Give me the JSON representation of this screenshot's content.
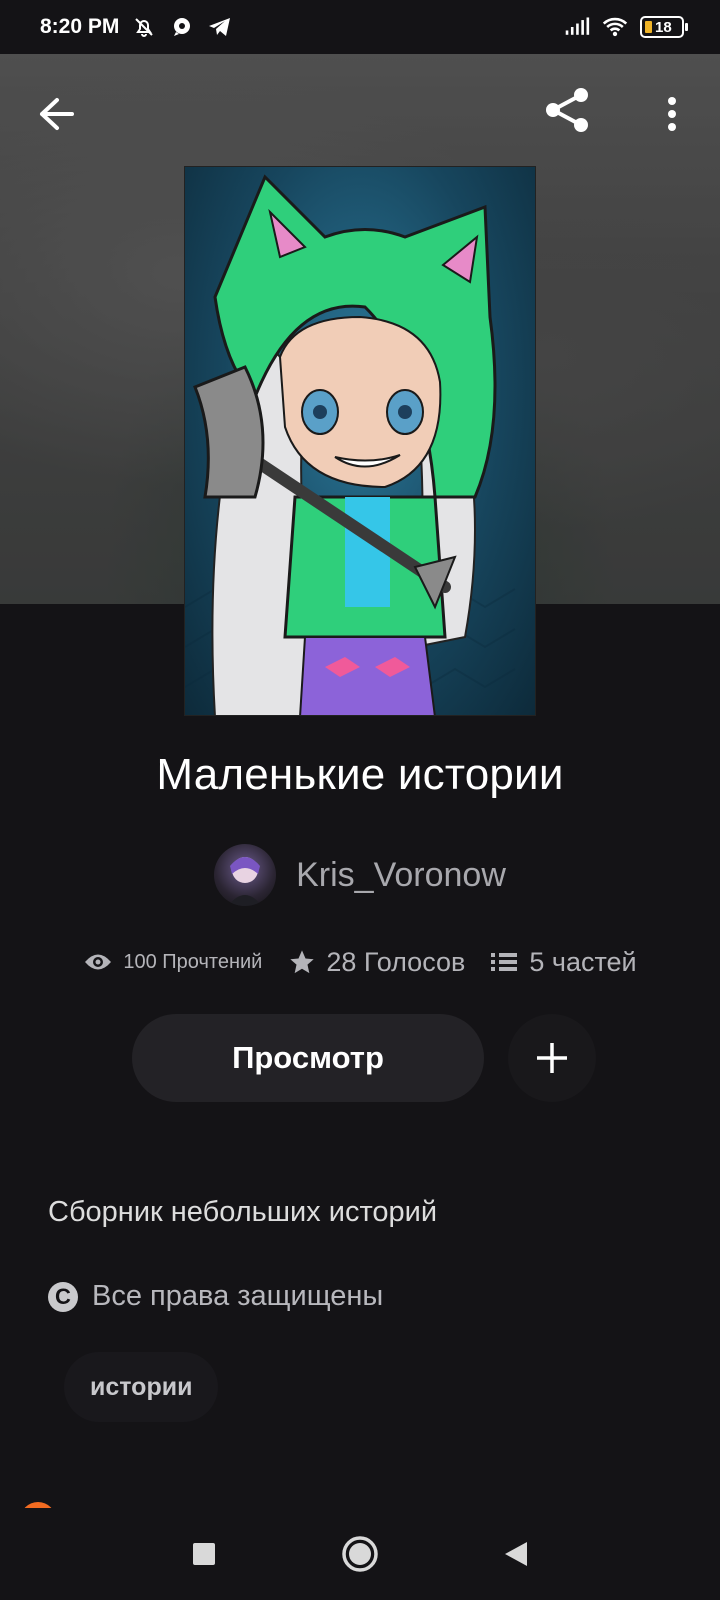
{
  "status_bar": {
    "time": "8:20 PM",
    "battery_level": "18",
    "icons": [
      "bell-off-icon",
      "chat-bubble-icon",
      "telegram-icon",
      "signal-icon",
      "wifi-icon",
      "battery-icon"
    ]
  },
  "header": {
    "back_icon": "arrow-left-icon",
    "share_icon": "share-icon",
    "more_icon": "more-vertical-icon"
  },
  "story": {
    "title": "Маленькие истории",
    "author": "Kris_Voronow",
    "stats": {
      "reads": "100 Прочтений",
      "votes": "28 Голосов",
      "parts": "5 частей"
    },
    "view_button": "Просмотр",
    "add_icon": "plus-icon",
    "description": "Сборник небольших историй",
    "rights": "Все права защищены",
    "rights_icon": "copyright-icon",
    "tags": [
      "истории"
    ],
    "rank_text": "#"
  },
  "colors": {
    "background": "#141316",
    "button": "#232226",
    "muted_text": "#b4b4b9",
    "accent": "#f26b21",
    "battery_fill": "#f0b428"
  }
}
